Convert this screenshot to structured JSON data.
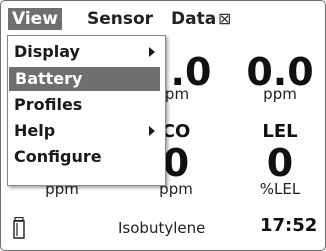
{
  "menubar": {
    "view": "View",
    "sensor": "Sensor",
    "data": "Data",
    "close_glyph": "⊠"
  },
  "dropdown": {
    "items": [
      {
        "label": "Display",
        "has_submenu": true
      },
      {
        "label": "Battery",
        "selected": true
      },
      {
        "label": "Profiles"
      },
      {
        "label": "Help",
        "has_submenu": true
      },
      {
        "label": "Configure"
      }
    ]
  },
  "sensors": {
    "top_middle": {
      "value": ".0",
      "unit": "pm"
    },
    "top_right": {
      "value": "0.0",
      "unit": "ppm"
    },
    "bottom_left": {
      "unit": "ppm"
    },
    "bottom_middle": {
      "label": "CO",
      "value": "0",
      "unit": "ppm"
    },
    "bottom_right": {
      "label": "LEL",
      "value": "0",
      "unit": "%LEL"
    }
  },
  "footer": {
    "icon": "gas-bottle-icon",
    "gas": "Isobutylene",
    "time": "17:52"
  }
}
